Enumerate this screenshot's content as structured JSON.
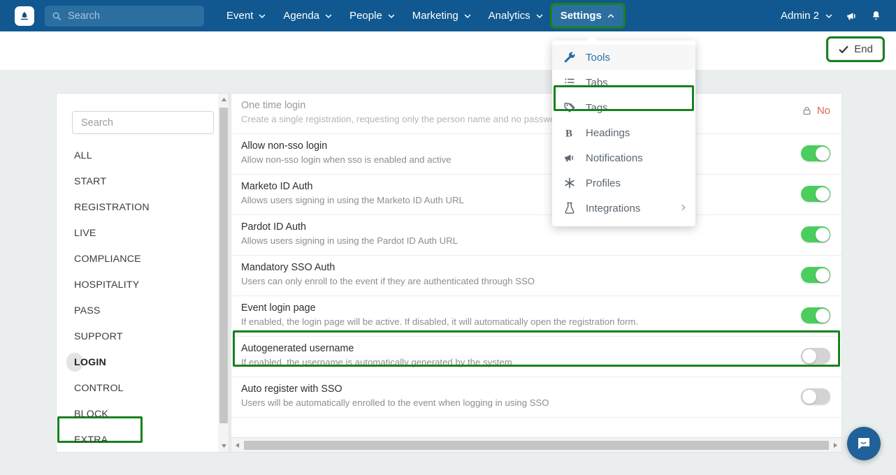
{
  "navbar": {
    "logo": "logo-icon",
    "search": {
      "placeholder": "Search"
    },
    "menu": [
      {
        "label": "Event",
        "active": false
      },
      {
        "label": "Agenda",
        "active": false
      },
      {
        "label": "People",
        "active": false
      },
      {
        "label": "Marketing",
        "active": false
      },
      {
        "label": "Analytics",
        "active": false
      },
      {
        "label": "Settings",
        "active": true
      }
    ],
    "account": {
      "label": "Admin 2"
    },
    "icons": [
      "megaphone-icon",
      "bell-icon"
    ]
  },
  "subheader": {
    "end_label": "End"
  },
  "dropdown": {
    "items": [
      {
        "label": "Tools",
        "icon": "wrench-icon",
        "active": true,
        "submenu": false
      },
      {
        "label": "Tabs",
        "icon": "list-icon",
        "active": false,
        "submenu": false
      },
      {
        "label": "Tags",
        "icon": "tag-icon",
        "active": false,
        "submenu": false
      },
      {
        "label": "Headings",
        "icon": "bold-b-icon",
        "active": false,
        "submenu": false
      },
      {
        "label": "Notifications",
        "icon": "megaphone-icon",
        "active": false,
        "submenu": false
      },
      {
        "label": "Profiles",
        "icon": "asterisk-icon",
        "active": false,
        "submenu": false
      },
      {
        "label": "Integrations",
        "icon": "flask-icon",
        "active": false,
        "submenu": true
      }
    ]
  },
  "sidebar": {
    "search": {
      "placeholder": "Search"
    },
    "items": [
      {
        "label": "ALL",
        "selected": false
      },
      {
        "label": "START",
        "selected": false
      },
      {
        "label": "REGISTRATION",
        "selected": false
      },
      {
        "label": "LIVE",
        "selected": false
      },
      {
        "label": "COMPLIANCE",
        "selected": false
      },
      {
        "label": "HOSPITALITY",
        "selected": false
      },
      {
        "label": "PASS",
        "selected": false
      },
      {
        "label": "SUPPORT",
        "selected": false
      },
      {
        "label": "LOGIN",
        "selected": true
      },
      {
        "label": "CONTROL",
        "selected": false
      },
      {
        "label": "BLOCK",
        "selected": false
      },
      {
        "label": "EXTRA",
        "selected": false
      }
    ]
  },
  "settings_rows": [
    {
      "title": "One time login",
      "desc": "Create a single registration, requesting only the person name and no password",
      "control": "locked",
      "locked_value": "No",
      "dim": true
    },
    {
      "title": "Allow non-sso login",
      "desc": "Allow non-sso login when sso is enabled and active",
      "control": "toggle",
      "on": true,
      "dim": false
    },
    {
      "title": "Marketo ID Auth",
      "desc": "Allows users signing in using the Marketo ID Auth URL",
      "control": "toggle",
      "on": true,
      "dim": false
    },
    {
      "title": "Pardot ID Auth",
      "desc": "Allows users signing in using the Pardot ID Auth URL",
      "control": "toggle",
      "on": true,
      "dim": false
    },
    {
      "title": "Mandatory SSO Auth",
      "desc": "Users can only enroll to the event if they are authenticated through SSO",
      "control": "toggle",
      "on": true,
      "dim": false
    },
    {
      "title": "Event login page",
      "desc": "If enabled, the login page will be active. If disabled, it will automatically open the registration form.",
      "control": "toggle",
      "on": true,
      "dim": false
    },
    {
      "title": "Autogenerated username",
      "desc": "If enabled, the username is automatically generated by the system",
      "control": "toggle",
      "on": false,
      "dim": false
    },
    {
      "title": "Auto register with SSO",
      "desc": "Users will be automatically enrolled to the event when logging in using SSO",
      "control": "toggle",
      "on": false,
      "dim": false
    }
  ],
  "chat": {
    "icon": "chat-bubble-icon"
  },
  "colors": {
    "navbar_blue": "#10588f",
    "nav_active_blue": "#2b6fa0",
    "highlight_green": "#17821f",
    "toggle_on_green": "#4cce5f",
    "toggle_off_gray": "#d3d3d3",
    "locked_red": "#e2694f",
    "dropdown_active_text": "#2a6ea8",
    "page_bg": "#eaeeee"
  }
}
